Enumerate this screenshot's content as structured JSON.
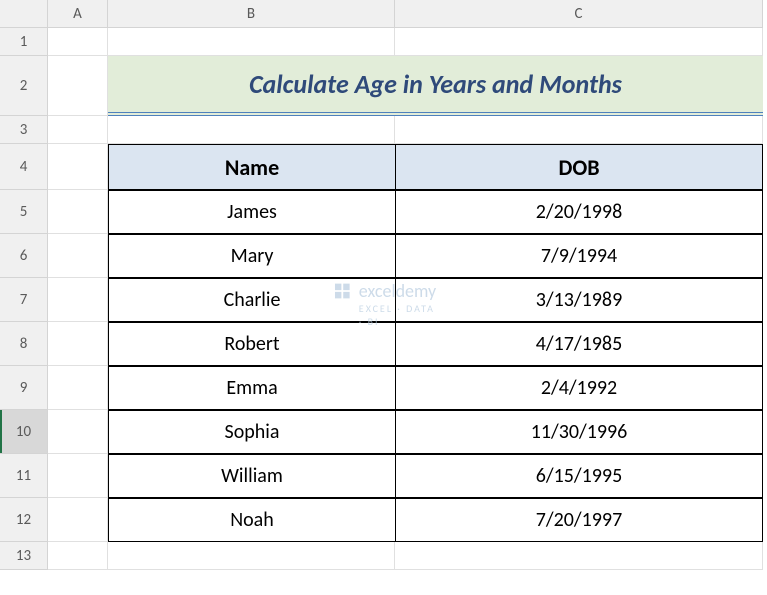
{
  "columns": [
    "A",
    "B",
    "C"
  ],
  "rows": [
    "1",
    "2",
    "3",
    "4",
    "5",
    "6",
    "7",
    "8",
    "9",
    "10",
    "11",
    "12",
    "13"
  ],
  "selected_row_index": 9,
  "title": "Calculate Age in Years and Months",
  "headers": {
    "name": "Name",
    "dob": "DOB"
  },
  "data": [
    {
      "name": "James",
      "dob": "2/20/1998"
    },
    {
      "name": "Mary",
      "dob": "7/9/1994"
    },
    {
      "name": "Charlie",
      "dob": "3/13/1989"
    },
    {
      "name": "Robert",
      "dob": "4/17/1985"
    },
    {
      "name": "Emma",
      "dob": "2/4/1992"
    },
    {
      "name": "Sophia",
      "dob": "11/30/1996"
    },
    {
      "name": "William",
      "dob": "6/15/1995"
    },
    {
      "name": "Noah",
      "dob": "7/20/1997"
    }
  ],
  "watermark": {
    "brand": "exceldemy",
    "tagline": "EXCEL · DATA · BI"
  }
}
